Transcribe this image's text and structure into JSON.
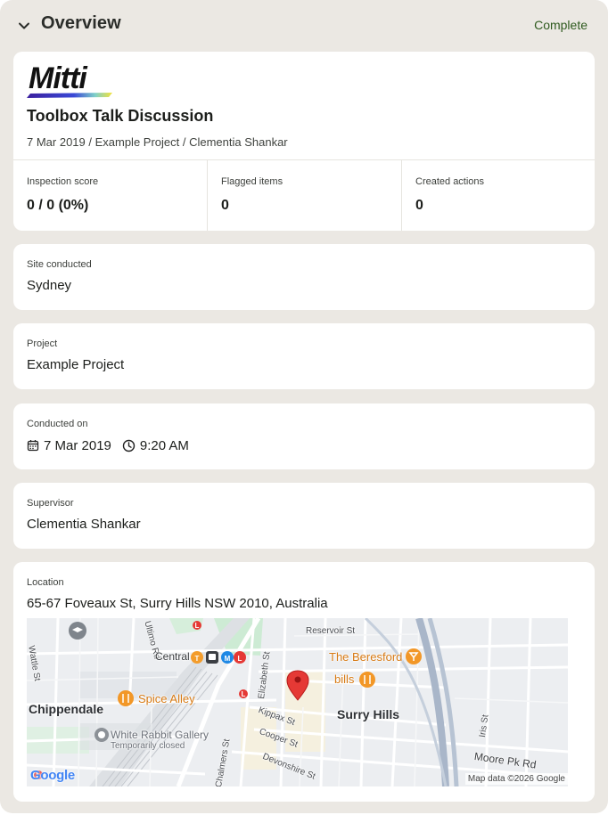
{
  "header": {
    "title": "Overview",
    "status": "Complete",
    "chevron_icon": "chevron-down-icon"
  },
  "summary": {
    "logo_text": "Mitti",
    "title": "Toolbox Talk Discussion",
    "subtitle": "7 Mar 2019 / Example Project / Clementia Shankar",
    "stats": [
      {
        "label": "Inspection score",
        "value": "0 / 0 (0%)"
      },
      {
        "label": "Flagged items",
        "value": "0"
      },
      {
        "label": "Created actions",
        "value": "0"
      }
    ]
  },
  "site": {
    "label": "Site conducted",
    "value": "Sydney"
  },
  "project": {
    "label": "Project",
    "value": "Example Project"
  },
  "conducted": {
    "label": "Conducted on",
    "date": "7 Mar 2019",
    "time": "9:20 AM",
    "date_icon": "calendar-icon",
    "time_icon": "clock-icon"
  },
  "supervisor": {
    "label": "Supervisor",
    "value": "Clementia Shankar"
  },
  "location": {
    "label": "Location",
    "address": "65-67 Foveaux St, Surry Hills NSW 2010, Australia",
    "map": {
      "labels": {
        "reservoir": "Reservoir St",
        "wattle": "Wattle St",
        "ultimo": "Ultimo Rd",
        "central": "Central",
        "elizabeth": "Elizabeth St",
        "beresford": "The Beresford",
        "bills": "bills",
        "spice": "Spice Alley",
        "chippendale": "Chippendale",
        "kippax": "Kippax St",
        "surry": "Surry Hills",
        "cooper": "Cooper St",
        "white_rabbit": "White Rabbit Gallery",
        "temp_closed": "Temporarily closed",
        "chalmers": "Chalmers St",
        "devonshire": "Devonshire St",
        "iris": "Iris St",
        "moore": "Moore Pk Rd",
        "marker": "M",
        "letter_t": "T",
        "letter_l": "L"
      },
      "google": "Google",
      "attribution": "Map data ©2026 Google",
      "pin_icon": "location-pin-icon"
    }
  },
  "colors": {
    "background": "#ebe8e3",
    "card": "#ffffff",
    "status_green": "#2e5a1e",
    "pin_red": "#e53935",
    "poi_orange": "#f29727"
  }
}
